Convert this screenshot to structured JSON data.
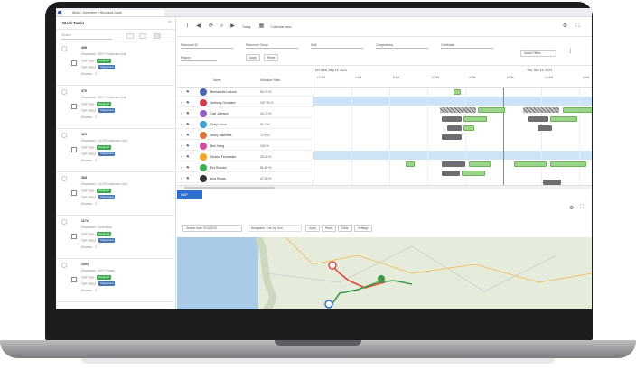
{
  "browser": {
    "tab_title": "Work > Scheduler > Resource Gantt"
  },
  "left_panel": {
    "title": "Work Tasks",
    "search_placeholder": "Search",
    "tasks": [
      {
        "id": "408",
        "desc": "Description : B3 FX Inspection Unit",
        "type_label": "Task Type",
        "type_badge": "Assigned",
        "status_label": "Task Status",
        "status_badge": "Dispatched",
        "duration": "Duration : 2"
      },
      {
        "id": "370",
        "desc": "Description : B3 FX Inspection Unit",
        "type_label": "Task Type",
        "type_badge": "Assigned",
        "status_label": "Task Status",
        "status_badge": "Dispatched",
        "duration": "Duration : 2"
      },
      {
        "id": "369",
        "desc": "Description : CU-SS Inspection Unit",
        "type_label": "Task Type",
        "type_badge": "Assigned",
        "status_label": "Task Status",
        "status_badge": "Dispatched",
        "duration": "Duration : 2"
      },
      {
        "id": "368",
        "desc": "Description : CU-SS Inspection Unit",
        "type_label": "Task Type",
        "type_badge": "Assigned",
        "status_label": "Task Status",
        "status_badge": "Dispatched",
        "duration": "Duration : 2"
      },
      {
        "id": "1174",
        "desc": "Description : Lock Work",
        "type_label": "Task Type",
        "type_badge": "Assigned",
        "status_label": "Task Status",
        "status_badge": "Dispatched",
        "duration": "Duration : 2"
      },
      {
        "id": "1003",
        "desc": "Description : X3 FX Install",
        "type_label": "Task Type",
        "type_badge": "Assigned",
        "status_label": "Task Status",
        "status_badge": "Dispatched",
        "duration": "Duration : 2"
      }
    ]
  },
  "toolbar": {
    "today_label": "Today",
    "view_label": "Calendar view",
    "resource_filter": "Resource ID",
    "resource_group": "Resource Group",
    "skill": "Skill",
    "competency": "Competency",
    "certificate": "Certificate",
    "region": "Region",
    "apply": "Apply",
    "reset": "Reset",
    "saved_filters": "Saved Filters"
  },
  "grid": {
    "col_name": "Name",
    "col_util": "Utilization Ratio",
    "rows": [
      {
        "name": "Bernadette Ladosh",
        "pct": "54.75 %",
        "color": "#4a64b8"
      },
      {
        "name": "Anthony Gonzalez",
        "pct": "107.93 %",
        "color": "#d23b4b"
      },
      {
        "name": "Carl Johnson",
        "pct": "34.75 %",
        "color": "#8e5cc8"
      },
      {
        "name": "Greg Lonzo",
        "pct": "31.7 %",
        "color": "#3aa0d6"
      },
      {
        "name": "Noely Valentine",
        "pct": "72.5 %",
        "color": "#d87939"
      },
      {
        "name": "Ben Hang",
        "pct": "100 %",
        "color": "#d84aa0"
      },
      {
        "name": "Monica Fernandes",
        "pct": "33.38 %",
        "color": "#f2a623"
      },
      {
        "name": "Rui Romani",
        "pct": "51.82 %",
        "color": "#3fae57"
      },
      {
        "name": "Ana Rosas",
        "pct": "47.69 %",
        "color": "#333333"
      }
    ]
  },
  "gantt": {
    "date1": "DD Wed, Sep 13, 2023",
    "date2": "Thu, Sep 14, 2023",
    "times": [
      "12 AM",
      "4 AM",
      "8 AM",
      "12 PM",
      "4 PM",
      "8 PM",
      "12 AM",
      "4 AM"
    ]
  },
  "map": {
    "tab_label": "MAP",
    "search_date": "Search Date: 9/13/2023",
    "navigation": "Navigation: Turn by Turn",
    "apply": "Apply",
    "reset": "Reset",
    "clear": "Clear",
    "settings": "Settings"
  }
}
